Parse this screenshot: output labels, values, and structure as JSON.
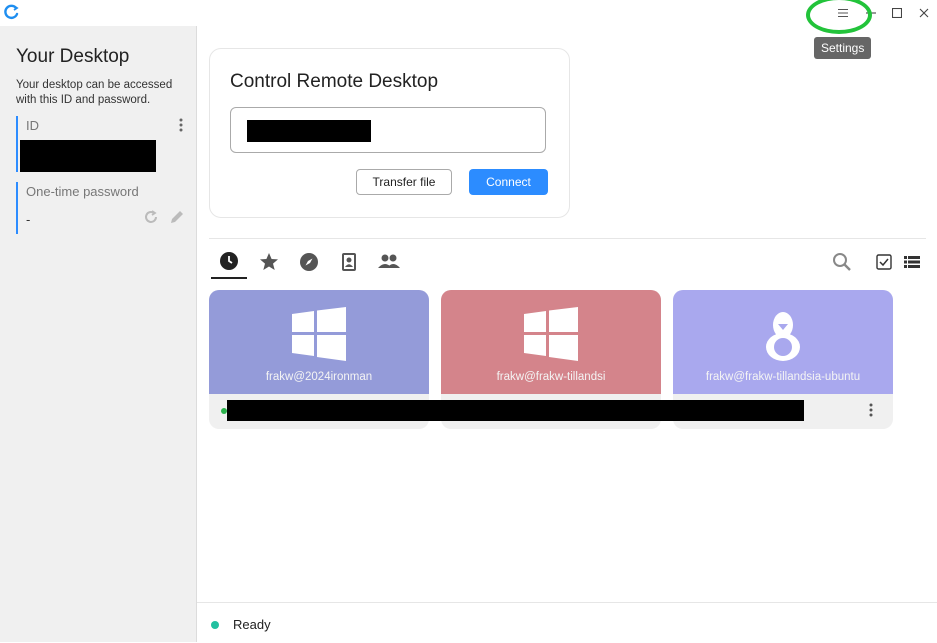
{
  "titlebar": {
    "menu_icon": "hamburger-menu-icon",
    "tooltip": "Settings"
  },
  "sidebar": {
    "title": "Your Desktop",
    "description": "Your desktop can be accessed with this ID and password.",
    "id_label": "ID",
    "password_label": "One-time password",
    "password_value": "-"
  },
  "control": {
    "title": "Control Remote Desktop",
    "transfer_label": "Transfer file",
    "connect_label": "Connect"
  },
  "tabs": [
    "recent-sessions-icon",
    "favorites-icon",
    "discovered-icon",
    "address-book-icon",
    "group-icon"
  ],
  "peers": [
    {
      "name": "frakw@2024ironman",
      "os": "windows",
      "color": "#949bd9"
    },
    {
      "name": "frakw@frakw-tillandsi",
      "os": "windows",
      "color": "#d4848b"
    },
    {
      "name": "frakw@frakw-tillandsia-ubuntu",
      "os": "linux",
      "color": "#a9a8ee"
    }
  ],
  "status": {
    "text": "Ready",
    "color": "#22c0a0"
  },
  "colors": {
    "accent": "#2c8cff",
    "online": "#2bb24c"
  }
}
